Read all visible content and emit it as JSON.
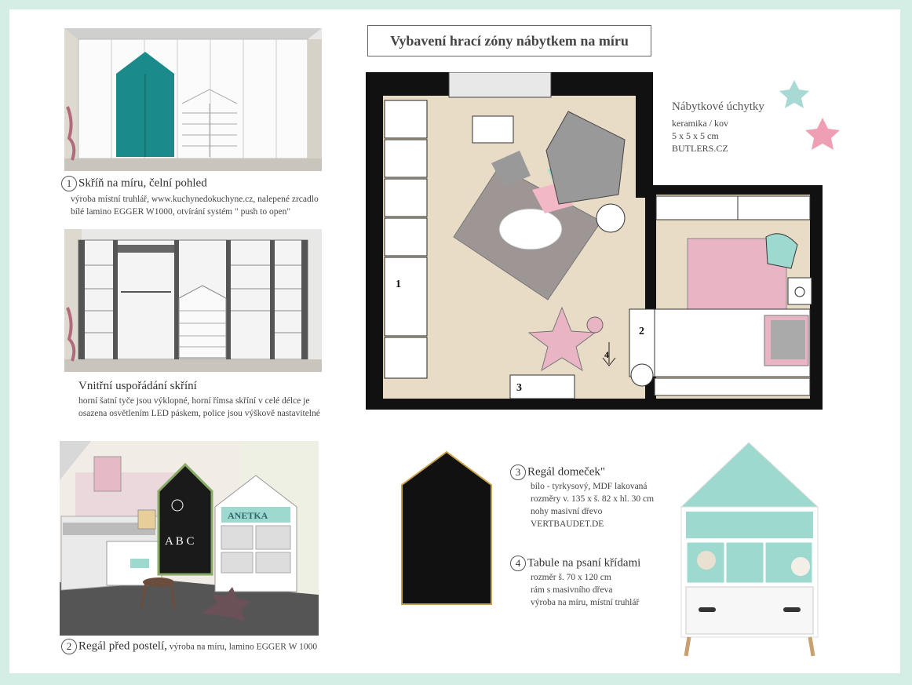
{
  "title": "Vybavení  hrací zóny nábytkem na míru",
  "caption1": {
    "num": "1",
    "heading": "Skříň na míru, čelní pohled",
    "line1": "výroba místní truhlář, www.kuchynedokuchyne.cz, nalepené zrcadlo",
    "line2": "bílé lamino EGGER W1000, otvírání systém \" push to open\""
  },
  "caption_inner": {
    "heading": "Vnitřní uspořádání skříní",
    "line1": "horní šatní tyče jsou výklopné, horní římsa skříní  v celé délce je",
    "line2": "osazena osvětlením LED páskem, police jsou výškově  nastavitelné"
  },
  "caption2": {
    "num": "2",
    "heading": "Regál před postelí,",
    "sub": " výroba na míru, lamino EGGER W 1000"
  },
  "handles": {
    "heading": "Nábytkové úchytky",
    "line1": "keramika / kov",
    "line2": "5 x 5 x 5 cm",
    "line3": "BUTLERS.CZ"
  },
  "caption3": {
    "num": "3",
    "heading": "Regál domeček\"",
    "line1": "bílo - tyrkysový, MDF lakovaná",
    "line2": "rozměry v. 135 x š. 82 x hl. 30 cm",
    "line3": "nohy masivní dřevo",
    "line4": "VERTBAUDET.DE"
  },
  "caption4": {
    "num": "4",
    "heading": "Tabule na psaní křídami",
    "line1": "rozměr š. 70 x 120 cm",
    "line2": "rám s masivního dřeva",
    "line3": "výroba na míru, místní truhlář"
  },
  "plan_labels": {
    "l1": "1",
    "l2": "2",
    "l3": "3",
    "l4": "4"
  },
  "shelf_sign": "ANETKA",
  "chalk_letters": "A B C",
  "colors": {
    "teal": "#1a8a8a",
    "mint": "#9ed9d0",
    "pink": "#e9b5c4",
    "wood": "#e8dcc6",
    "wall": "#111111"
  }
}
